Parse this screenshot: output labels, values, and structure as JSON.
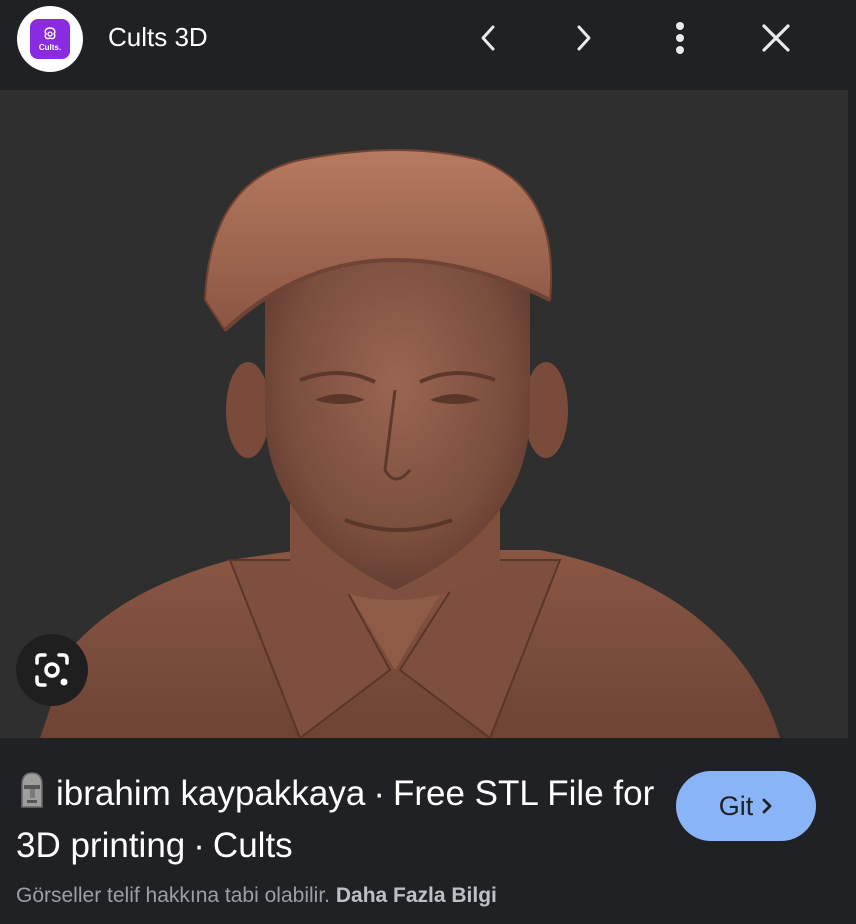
{
  "header": {
    "logo_text": "Cults.",
    "site_name": "Cults 3D",
    "icons": [
      "chevron-left-icon",
      "chevron-right-icon",
      "more-vert-icon",
      "close-icon"
    ]
  },
  "preview": {
    "description_icon": "lens-icon"
  },
  "result": {
    "emoji": "moai-icon",
    "title_part1": "ibrahim kaypakkaya",
    "separator": "·",
    "title_part2": "Free STL File for 3D printing",
    "title_part3": "Cults",
    "visit_label": "Git"
  },
  "footer": {
    "copyright_text": "Görseller telif hakkına tabi olabilir.",
    "learn_more": "Daha Fazla Bilgi"
  },
  "colors": {
    "background": "#202124",
    "image_bg": "#2f2f2f",
    "accent": "#8ab4f8",
    "logo_purple": "#8a2be2"
  }
}
